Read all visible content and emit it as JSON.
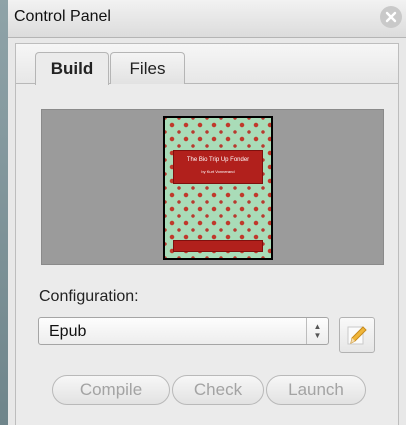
{
  "window": {
    "title": "Control Panel",
    "close_icon": "close-icon"
  },
  "tabs": [
    {
      "label": "Build",
      "active": true
    },
    {
      "label": "Files",
      "active": false
    }
  ],
  "preview": {
    "book_title": "The Bio Trip Up Fonder",
    "book_author": "by Kurt Vonnerand"
  },
  "configuration": {
    "label": "Configuration:",
    "selected": "Epub",
    "edit_icon": "pencil-icon"
  },
  "actions": {
    "compile": "Compile",
    "check": "Check",
    "launch": "Launch",
    "enabled": false
  },
  "colors": {
    "book_background": "#a9dcb8",
    "book_band": "#b1201c",
    "disabled_text": "#a3a3a3"
  }
}
